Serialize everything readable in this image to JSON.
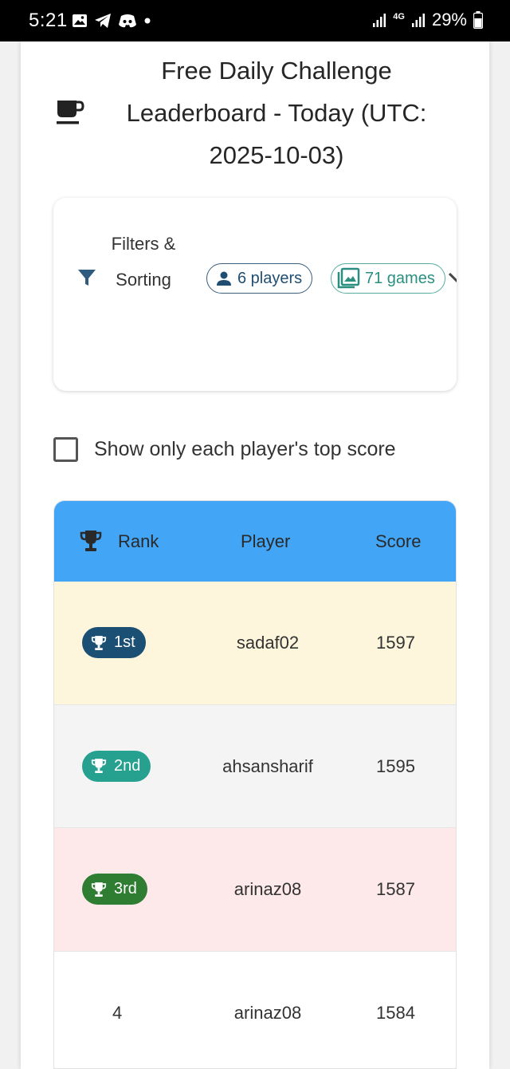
{
  "status_bar": {
    "time": "5:21",
    "battery": "29%",
    "network": "4G",
    "icons": [
      "image-icon",
      "telegram-icon",
      "discord-icon",
      "dot-icon",
      "signal-icon",
      "signal-icon",
      "battery-icon"
    ]
  },
  "header": {
    "icon": "coffee-cup-icon",
    "title": "Free Daily Challenge Leaderboard - Today (UTC: 2025-10-03)"
  },
  "filters": {
    "icon": "filter-icon",
    "label": "Filters & Sorting",
    "chips": {
      "players": {
        "icon": "person-icon",
        "label": "6 players"
      },
      "games": {
        "icon": "image-stack-icon",
        "label": "71 games"
      }
    }
  },
  "top_score_toggle": {
    "label": "Show only each player's top score",
    "checked": false
  },
  "leaderboard": {
    "columns": {
      "rank": "Rank",
      "player": "Player",
      "score": "Score"
    },
    "rows": [
      {
        "rank": "1st",
        "player": "sadaf02",
        "score": "1597",
        "badge_color": "#1b4f74",
        "row_color": "#fdf6dc"
      },
      {
        "rank": "2nd",
        "player": "ahsansharif",
        "score": "1595",
        "badge_color": "#26a08f",
        "row_color": "#f4f4f4"
      },
      {
        "rank": "3rd",
        "player": "arinaz08",
        "score": "1587",
        "badge_color": "#2e7d32",
        "row_color": "#fde9ea"
      },
      {
        "rank": "4",
        "player": "arinaz08",
        "score": "1584",
        "row_color": "#ffffff"
      }
    ]
  },
  "colors": {
    "header_bg": "#42a5f5",
    "accent_dark": "#1f4e72",
    "accent_teal": "#2a8f80"
  }
}
